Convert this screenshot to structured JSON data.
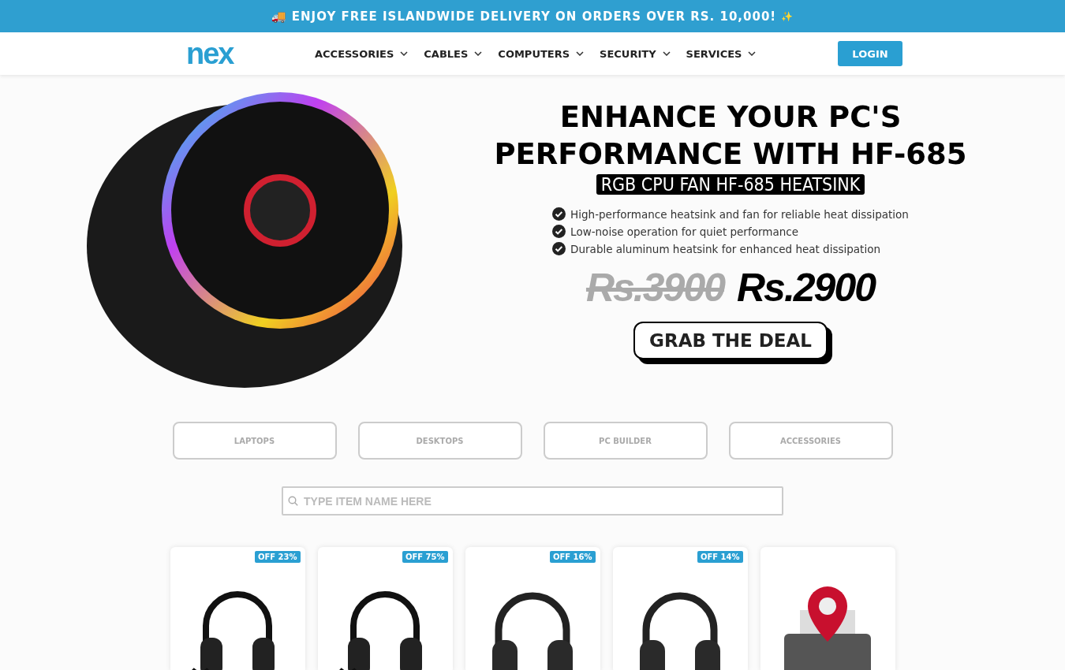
{
  "promo_bar": {
    "icon": "🚚",
    "text": "ENJOY FREE ISLANDWIDE DELIVERY ON ORDERS OVER RS. 10,000!",
    "trailing_icon": "✨"
  },
  "header": {
    "logo": "nex",
    "nav": [
      {
        "label": "ACCESSORIES"
      },
      {
        "label": "CABLES"
      },
      {
        "label": "COMPUTERS"
      },
      {
        "label": "SECURITY"
      },
      {
        "label": "SERVICES"
      }
    ],
    "login": "LOGIN"
  },
  "hero": {
    "title": "ENHANCE YOUR PC'S PERFORMANCE WITH HF-685",
    "subtitle": "RGB CPU FAN HF-685 HEATSINK",
    "features": [
      "High-performance heatsink and fan for reliable heat dissipation",
      "Low-noise operation for quiet performance",
      "Durable aluminum heatsink for enhanced heat dissipation"
    ],
    "old_price": "Rs.3900",
    "price": "Rs.2900",
    "cta": "GRAB THE DEAL"
  },
  "categories": [
    "LAPTOPS",
    "DESKTOPS",
    "PC BUILDER",
    "ACCESSORIES"
  ],
  "search": {
    "placeholder": "TYPE ITEM NAME HERE"
  },
  "products": [
    {
      "kind": "headset",
      "badge": "OFF 23%"
    },
    {
      "kind": "headset",
      "badge": "OFF 75%"
    },
    {
      "kind": "headphones",
      "badge": "OFF 16%"
    },
    {
      "kind": "headphones",
      "badge": "OFF 14%"
    },
    {
      "kind": "printer"
    }
  ]
}
